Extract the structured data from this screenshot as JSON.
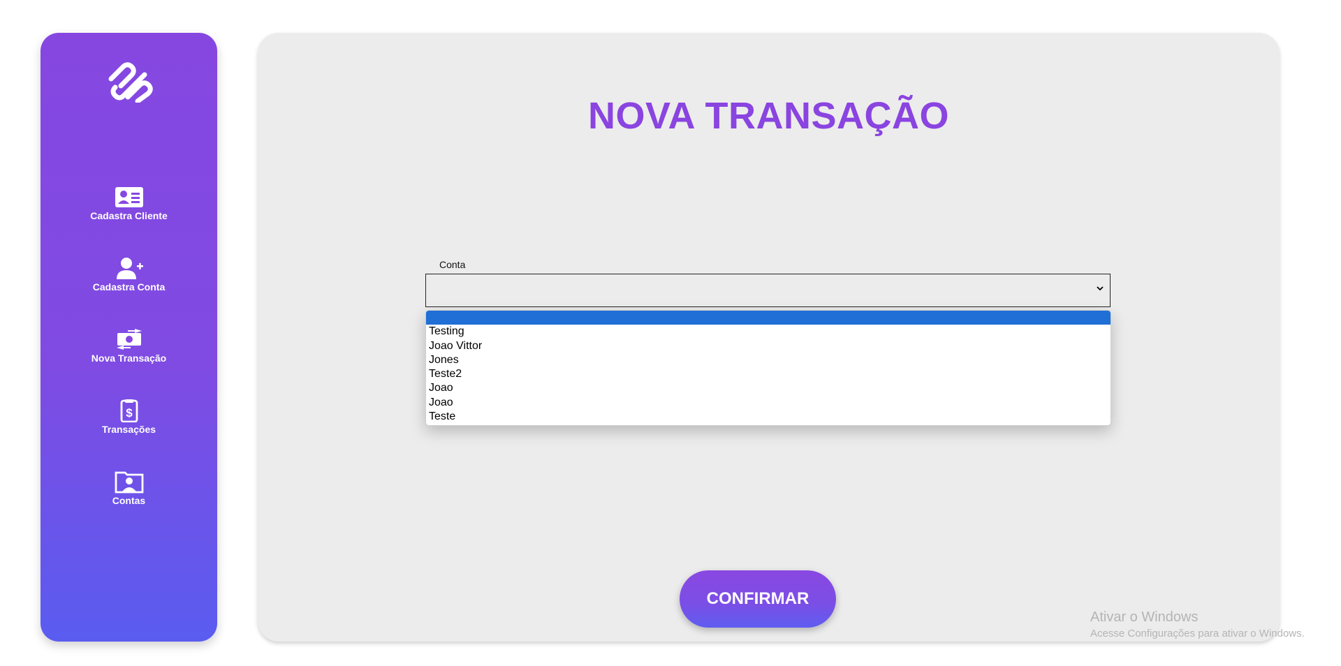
{
  "app": {
    "page_title": "NOVA TRANSAÇÃO"
  },
  "sidebar": {
    "logo_icon": "paperclip-logo",
    "items": [
      {
        "label": "Cadastra Cliente",
        "icon": "id-card-icon"
      },
      {
        "label": "Cadastra Conta",
        "icon": "user-plus-icon"
      },
      {
        "label": "Nova Transação",
        "icon": "money-transfer-icon"
      },
      {
        "label": "Transações",
        "icon": "clipboard-dollar-icon"
      },
      {
        "label": "Contas",
        "icon": "folder-user-icon"
      }
    ]
  },
  "form": {
    "conta_label": "Conta",
    "conta_value": "",
    "conta_options": [
      "",
      "Testing",
      "Joao Vittor",
      "Jones",
      "Teste2",
      "Joao",
      "Joao",
      "Teste"
    ],
    "confirm_label": "CONFIRMAR"
  },
  "watermark": {
    "title": "Ativar o Windows",
    "subtitle": "Acesse Configurações para ativar o Windows."
  },
  "colors": {
    "accent": "#8a44e0",
    "sidebar_top": "#8647e1",
    "sidebar_bottom": "#5a5cf0",
    "selected_option": "#1f6fd6",
    "panel_bg": "#ececec"
  }
}
